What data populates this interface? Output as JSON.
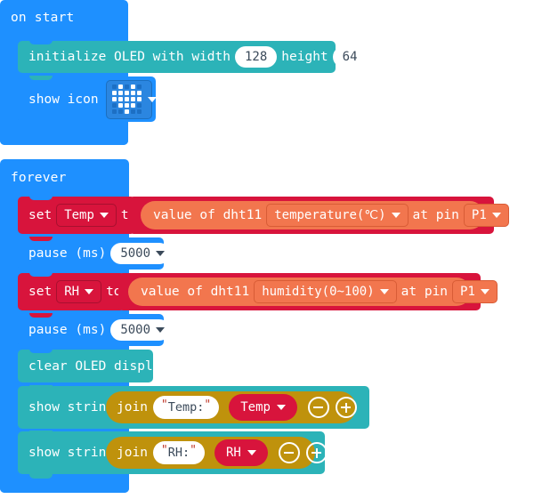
{
  "palette": {
    "event_blue": "#1E90FF",
    "oled_teal": "#2CB3B8",
    "variable_red": "#D8143C",
    "text_gold": "#BF920C",
    "sensor_orange": "#F2764E",
    "field_white": "#FFFFFF"
  },
  "scripts": [
    {
      "id": "on-start",
      "kind": "hat",
      "label": "on start",
      "children": [
        {
          "id": "initialize-oled",
          "kind": "statement",
          "color": "teal",
          "parts": [
            {
              "type": "text",
              "value": "initialize OLED with width"
            },
            {
              "type": "field",
              "name": "width",
              "value": "128"
            },
            {
              "type": "text",
              "value": "height"
            },
            {
              "type": "field",
              "name": "height",
              "value": "64"
            }
          ]
        },
        {
          "id": "show-icon",
          "kind": "statement",
          "color": "blue",
          "parts": [
            {
              "type": "text",
              "value": "show icon"
            },
            {
              "type": "icon-matrix",
              "name": "icon",
              "value": "Heart",
              "rows": [
                [
                  0,
                  1,
                  0,
                  1,
                  0
                ],
                [
                  1,
                  1,
                  1,
                  1,
                  1
                ],
                [
                  1,
                  1,
                  1,
                  1,
                  1
                ],
                [
                  0,
                  1,
                  1,
                  1,
                  0
                ],
                [
                  0,
                  0,
                  1,
                  0,
                  0
                ]
              ]
            }
          ]
        }
      ]
    },
    {
      "id": "forever",
      "kind": "hat",
      "label": "forever",
      "children": [
        {
          "id": "set-temp",
          "kind": "statement",
          "color": "red",
          "parts": [
            {
              "type": "text",
              "value": "set"
            },
            {
              "type": "dropdown",
              "name": "variable",
              "value": "Temp"
            },
            {
              "type": "text",
              "value": "to"
            }
          ],
          "reporter": {
            "id": "dht11-temperature",
            "color": "orange",
            "parts": [
              {
                "type": "text",
                "value": "value of dht11"
              },
              {
                "type": "dropdown",
                "name": "reading",
                "value": "temperature(℃)"
              },
              {
                "type": "text",
                "value": "at pin"
              },
              {
                "type": "dropdown",
                "name": "pin",
                "value": "P1"
              }
            ]
          }
        },
        {
          "id": "pause-1",
          "kind": "statement",
          "color": "blue",
          "parts": [
            {
              "type": "text",
              "value": "pause (ms)"
            },
            {
              "type": "field-caret",
              "name": "duration",
              "value": "5000"
            }
          ]
        },
        {
          "id": "set-rh",
          "kind": "statement",
          "color": "red",
          "parts": [
            {
              "type": "text",
              "value": "set"
            },
            {
              "type": "dropdown",
              "name": "variable",
              "value": "RH"
            },
            {
              "type": "text",
              "value": "to"
            }
          ],
          "reporter": {
            "id": "dht11-humidity",
            "color": "orange",
            "parts": [
              {
                "type": "text",
                "value": "value of dht11"
              },
              {
                "type": "dropdown",
                "name": "reading",
                "value": "humidity(0~100)"
              },
              {
                "type": "text",
                "value": "at pin"
              },
              {
                "type": "dropdown",
                "name": "pin",
                "value": "P1"
              }
            ]
          }
        },
        {
          "id": "pause-2",
          "kind": "statement",
          "color": "blue",
          "parts": [
            {
              "type": "text",
              "value": "pause (ms)"
            },
            {
              "type": "field-caret",
              "name": "duration",
              "value": "5000"
            }
          ]
        },
        {
          "id": "clear-oled",
          "kind": "statement",
          "color": "teal",
          "parts": [
            {
              "type": "text",
              "value": "clear OLED display"
            }
          ]
        },
        {
          "id": "show-string-temp",
          "kind": "statement",
          "color": "teal",
          "parts": [
            {
              "type": "text",
              "value": "show string"
            }
          ],
          "reporter": {
            "id": "join-temp",
            "color": "gold",
            "parts": [
              {
                "type": "text",
                "value": "join"
              },
              {
                "type": "string",
                "name": "prefix",
                "value": "Temp:"
              },
              {
                "type": "variable",
                "name": "value",
                "value": "Temp"
              },
              {
                "type": "mutator-minus",
                "name": "remove-item"
              },
              {
                "type": "mutator-plus",
                "name": "add-item"
              }
            ]
          }
        },
        {
          "id": "show-string-rh",
          "kind": "statement",
          "color": "teal",
          "parts": [
            {
              "type": "text",
              "value": "show string"
            }
          ],
          "reporter": {
            "id": "join-rh",
            "color": "gold",
            "parts": [
              {
                "type": "text",
                "value": "join"
              },
              {
                "type": "string",
                "name": "prefix",
                "value": "RH:"
              },
              {
                "type": "variable",
                "name": "value",
                "value": "RH"
              },
              {
                "type": "mutator-minus",
                "name": "remove-item"
              },
              {
                "type": "mutator-plus",
                "name": "add-item"
              }
            ]
          }
        }
      ]
    }
  ]
}
